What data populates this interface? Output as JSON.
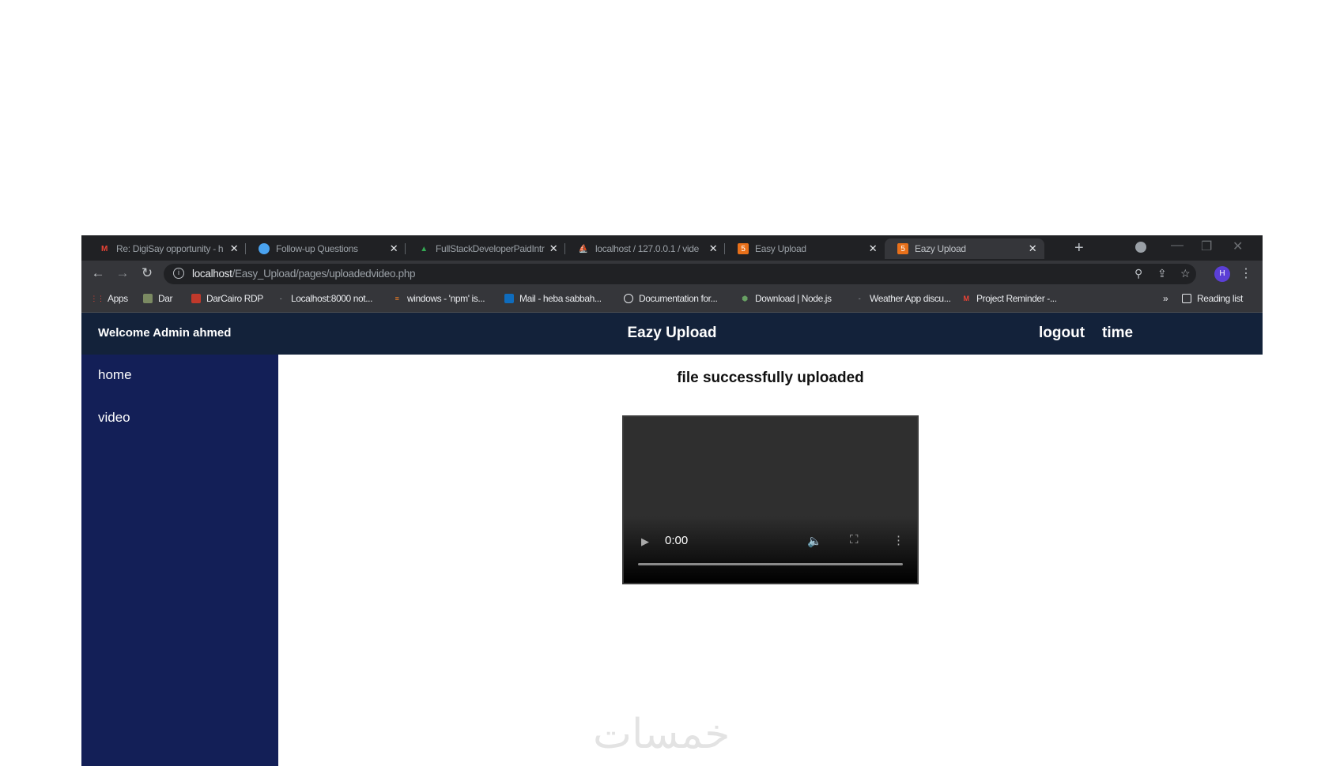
{
  "browser": {
    "tabs": [
      {
        "title": "Re: DigiSay opportunity - h",
        "icon": "gmail-icon"
      },
      {
        "title": "Follow-up Questions",
        "icon": "globe-icon"
      },
      {
        "title": "FullStackDeveloperPaidIntr",
        "icon": "google-drive-icon"
      },
      {
        "title": "localhost / 127.0.0.1 / vide",
        "icon": "phpmyadmin-icon"
      },
      {
        "title": "Easy Upload",
        "icon": "html-icon"
      },
      {
        "title": "Eazy Upload",
        "icon": "html-icon"
      }
    ],
    "new_tab_label": "+",
    "address": {
      "host": "localhost",
      "path": "/Easy_Upload/pages/uploadedvideo.php"
    },
    "profile_initial": "H",
    "bookmarks": [
      {
        "label": "Apps",
        "icon": "apps-grid-icon"
      },
      {
        "label": "Dar",
        "icon": "folder-icon"
      },
      {
        "label": "DarCairo RDP",
        "icon": "rdp-icon"
      },
      {
        "label": "Localhost:8000 not...",
        "icon": "page-icon"
      },
      {
        "label": "windows - 'npm' is...",
        "icon": "stackoverflow-icon"
      },
      {
        "label": "Mail - heba sabbah...",
        "icon": "outlook-icon"
      },
      {
        "label": "Documentation for...",
        "icon": "globe-icon"
      },
      {
        "label": "Download | Node.js",
        "icon": "nodejs-icon"
      },
      {
        "label": "Weather App discu...",
        "icon": "page-icon"
      },
      {
        "label": "Project Reminder -...",
        "icon": "gmail-icon"
      }
    ],
    "bookmarks_overflow": "»",
    "reading_list": "Reading list"
  },
  "page": {
    "welcome": "Welcome Admin ahmed",
    "brand": "Eazy Upload",
    "logout": "logout",
    "time": "time",
    "sidebar": [
      {
        "label": "home"
      },
      {
        "label": "video"
      }
    ],
    "message": "file successfully uploaded",
    "video": {
      "time": "0:00",
      "progress": 0
    }
  },
  "watermark": "خمسات"
}
